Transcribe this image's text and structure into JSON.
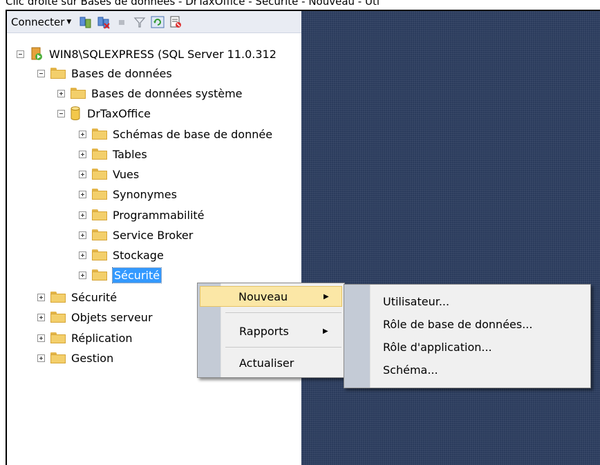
{
  "caption": "Clic droite sur Bases de données - DrTaxOffice - Sécurité - Nouveau - Uti",
  "toolbar": {
    "connect_label": "Connecter",
    "icons": [
      "register-server-icon",
      "disconnect-icon",
      "stop-icon",
      "filter-icon",
      "refresh-icon",
      "script-icon"
    ]
  },
  "tree": {
    "server": "WIN8\\SQLEXPRESS (SQL Server 11.0.312",
    "databases": "Bases de données",
    "system_databases": "Bases de données système",
    "database_name": "DrTaxOffice",
    "db_children": [
      "Schémas de base de donnée",
      "Tables",
      "Vues",
      "Synonymes",
      "Programmabilité",
      "Service Broker",
      "Stockage",
      "Sécurité"
    ],
    "root_children": [
      "Sécurité",
      "Objets serveur",
      "Réplication",
      "Gestion"
    ]
  },
  "context_menu": {
    "items": [
      "Nouveau",
      "Rapports",
      "Actualiser"
    ],
    "highlighted": "Nouveau"
  },
  "submenu": {
    "items": [
      "Utilisateur...",
      "Rôle de base de données...",
      "Rôle d'application...",
      "Schéma..."
    ]
  },
  "colors": {
    "selection": "#3399ff",
    "menu_highlight": "#fbe7a6",
    "desktop": "#2a3b5c",
    "folder": "#f3cf6b"
  }
}
